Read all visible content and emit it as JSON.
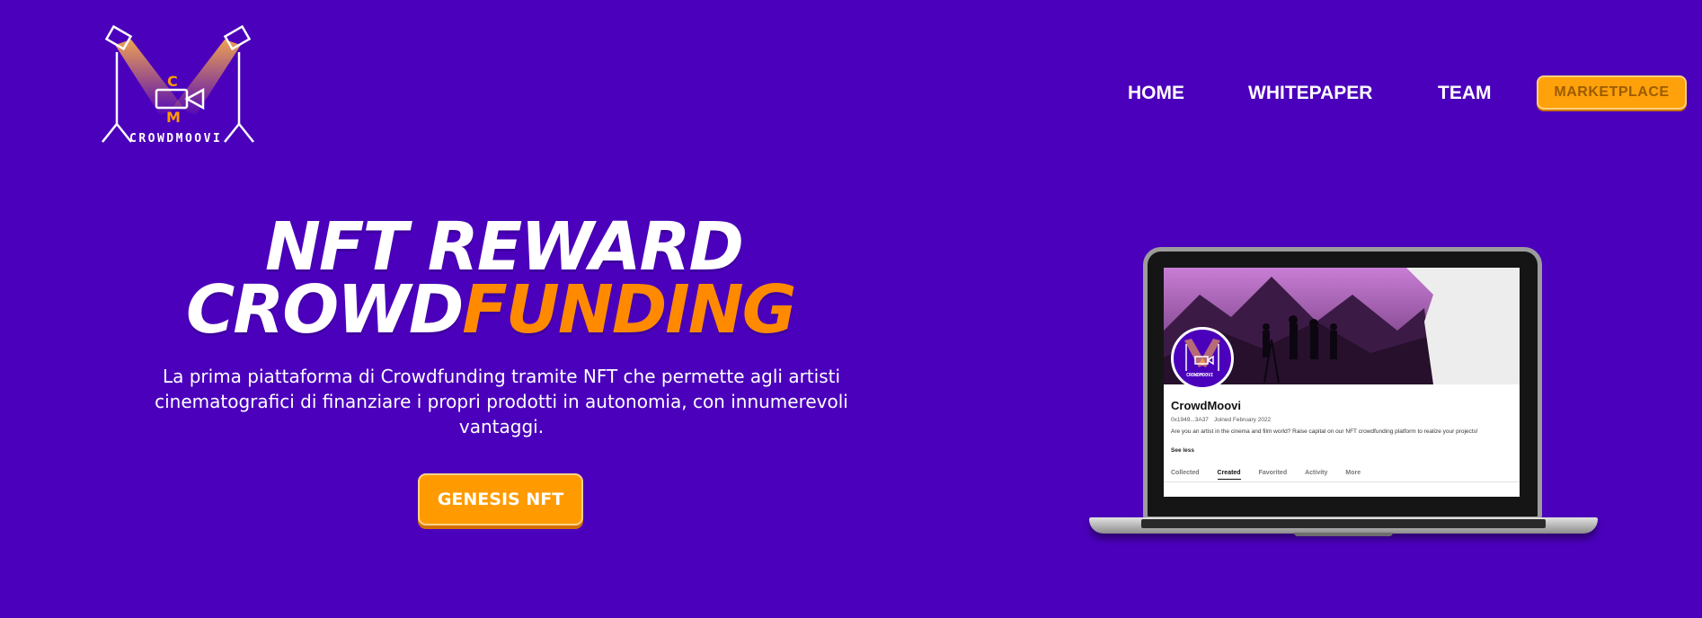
{
  "logo": {
    "brand": "CROWDMOOVI",
    "letters": [
      "C",
      "M"
    ]
  },
  "nav": {
    "home": "HOME",
    "whitepaper": "WHITEPAPER",
    "team": "TEAM",
    "marketplace": "MARKETPLACE"
  },
  "hero": {
    "line1": "NFT REWARD",
    "line2_white": "CROWD",
    "line2_orange": "FUNDING",
    "description": "La prima piattaforma di Crowdfunding tramite NFT che permette agli artisti cinematografici di finanziare i propri prodotti in autonomia, con innumerevoli vantaggi.",
    "cta": "GENESIS NFT"
  },
  "laptop_screen": {
    "avatar_brand": "CROWDMOOVI",
    "name": "CrowdMoovi",
    "address": "0x1949...3A37",
    "joined": "Joined February 2022",
    "bio": "Are you an artist in the cinema and film world? Raise capital on our NFT crowdfunding platform to realize your projects!",
    "see_less": "See less",
    "tabs": [
      "Collected",
      "Created",
      "Favorited",
      "Activity",
      "More"
    ]
  },
  "colors": {
    "background": "#4b00bc",
    "accent": "#ff9b00",
    "headline_orange": "#ff8a00"
  }
}
